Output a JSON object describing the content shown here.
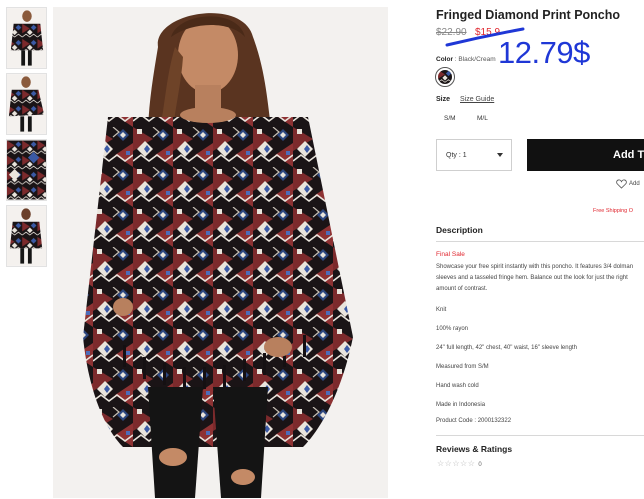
{
  "product": {
    "title": "Fringed Diamond Print Poncho",
    "original_price": "$22.90",
    "sale_price": "$15.9",
    "handwritten_price": "12.79$",
    "color_label": "Color",
    "color_value": "Black/Cream",
    "swatch_color": "#7a2f2b",
    "size_label": "Size",
    "size_guide": "Size Guide",
    "sizes": [
      "S/M",
      "M/L"
    ],
    "quantity": "Qty : 1",
    "add_to_bag": "Add T",
    "wishlist": "Add",
    "free_shipping": "Free Shipping O"
  },
  "description": {
    "heading": "Description",
    "final_sale": "Final Sale",
    "body": "Showcase your free spirit instantly with this poncho. It features 3/4 dolman sleeves and a tasseled fringe hem. Balance out the look for just the right amount of contrast.",
    "specs": [
      "Knit",
      "100% rayon",
      "24\" full length, 42\" chest, 40\" waist, 16\" sleeve length",
      "Measured from S/M",
      "Hand wash cold",
      "Made in Indonesia",
      "Product Code : 2000132322"
    ]
  },
  "reviews": {
    "heading": "Reviews & Ratings",
    "stars": "☆☆☆☆☆",
    "count": "0"
  },
  "colors": {
    "accent_red": "#e0272f",
    "ink_blue": "#1f37d6",
    "button_black": "#111111"
  }
}
